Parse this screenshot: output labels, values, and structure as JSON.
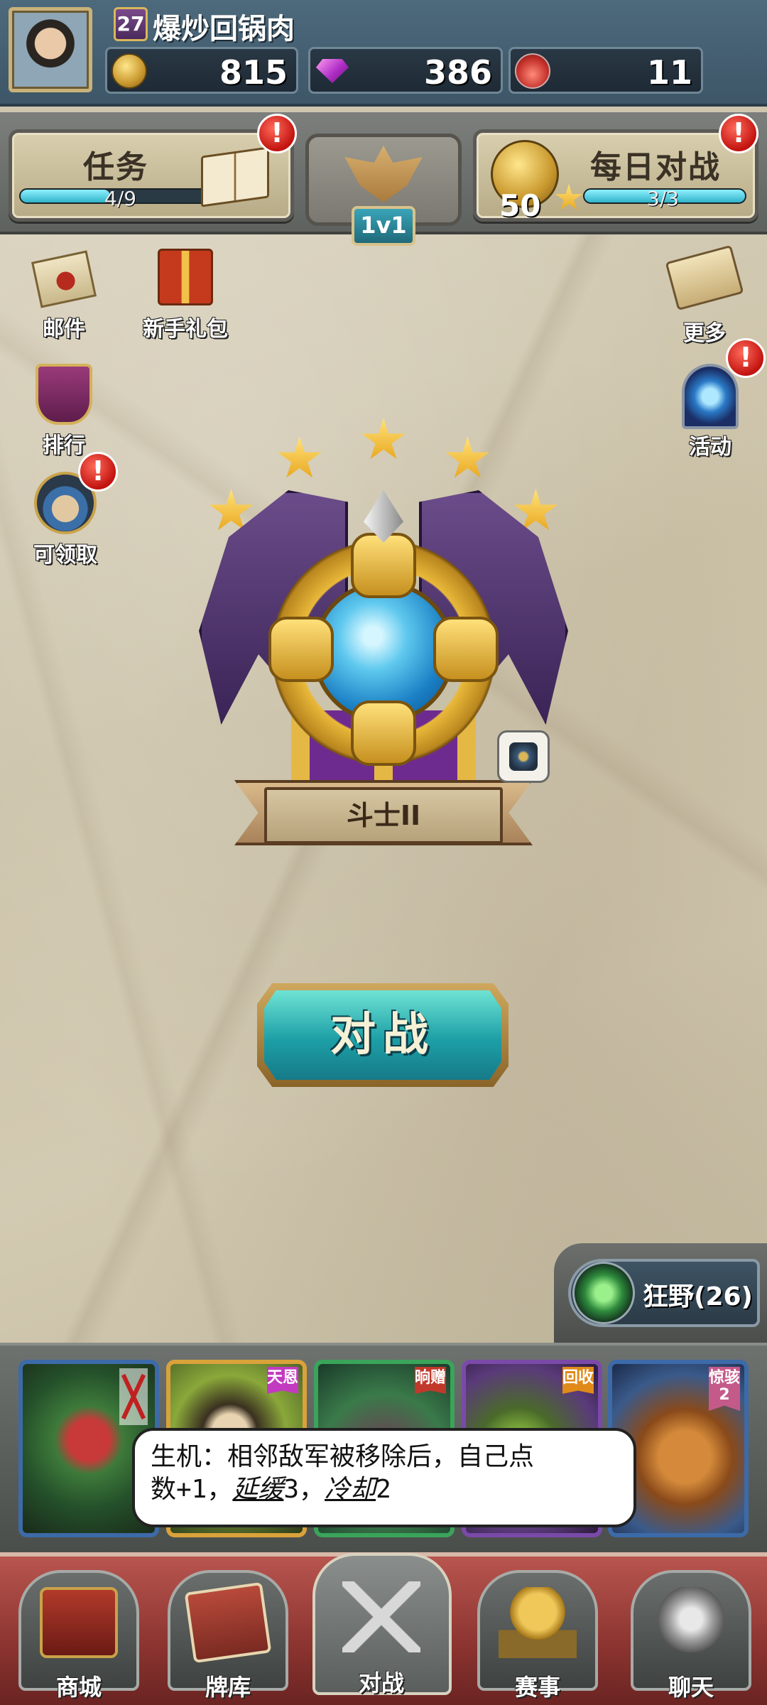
{
  "player": {
    "level": "27",
    "name": "爆炒回锅肉"
  },
  "currencies": [
    {
      "icon": "gold-coin-icon",
      "value": "815"
    },
    {
      "icon": "gem-icon",
      "value": "386"
    },
    {
      "icon": "potion-icon",
      "value": "11"
    }
  ],
  "quests": {
    "task_label": "任务",
    "task_progress": "4/9",
    "task_fraction": 0.44,
    "mode_label": "1v1",
    "daily_label": "每日对战",
    "daily_reward": "50",
    "daily_progress": "3/3",
    "daily_fraction": 1.0,
    "alert": "!"
  },
  "side_left": [
    {
      "label": "邮件",
      "icon": "mail-icon"
    },
    {
      "label": "新手礼包",
      "icon": "gift-icon"
    },
    {
      "label": "排行",
      "icon": "ranking-icon"
    },
    {
      "label": "可领取",
      "icon": "hero-portrait-icon"
    }
  ],
  "side_right": [
    {
      "label": "更多",
      "icon": "scroll-magnifier-icon"
    },
    {
      "label": "活动",
      "icon": "portal-icon"
    }
  ],
  "rank": {
    "stars": 5,
    "title": "斗士II"
  },
  "battle_button": "对战",
  "faction": {
    "label": "狂野(26)"
  },
  "cards": [
    {
      "tag": "",
      "border": "#3d6aa8"
    },
    {
      "tag": "天恩",
      "tag_color": "#c23ac0",
      "border": "#d9a23a"
    },
    {
      "tag": "晌赠",
      "tag_color": "#c0392b",
      "border": "#3aa45a"
    },
    {
      "tag": "回收",
      "tag_color": "#e08a1a",
      "border": "#7a4aa8"
    },
    {
      "tag": "惊骇2",
      "tag_color": "#c45a8a",
      "border": "#3d6aa8"
    }
  ],
  "tooltip": {
    "line1": "生机：相邻敌军被移除后，自己点",
    "line2_a": "数+1，",
    "kw1": "延缓",
    "line2_b": "3，",
    "kw2": "冷却",
    "line2_c": "2"
  },
  "nav": [
    {
      "label": "商城",
      "icon": "shop-chest-icon"
    },
    {
      "label": "牌库",
      "icon": "card-deck-icon"
    },
    {
      "label": "对战",
      "icon": "crossed-swords-icon"
    },
    {
      "label": "赛事",
      "icon": "trophy-icon"
    },
    {
      "label": "聊天",
      "icon": "gauntlet-icon"
    }
  ],
  "colors": {
    "accent_teal": "#1d9fa6",
    "alert_red": "#c2130f",
    "nav_red": "#8c3430"
  }
}
